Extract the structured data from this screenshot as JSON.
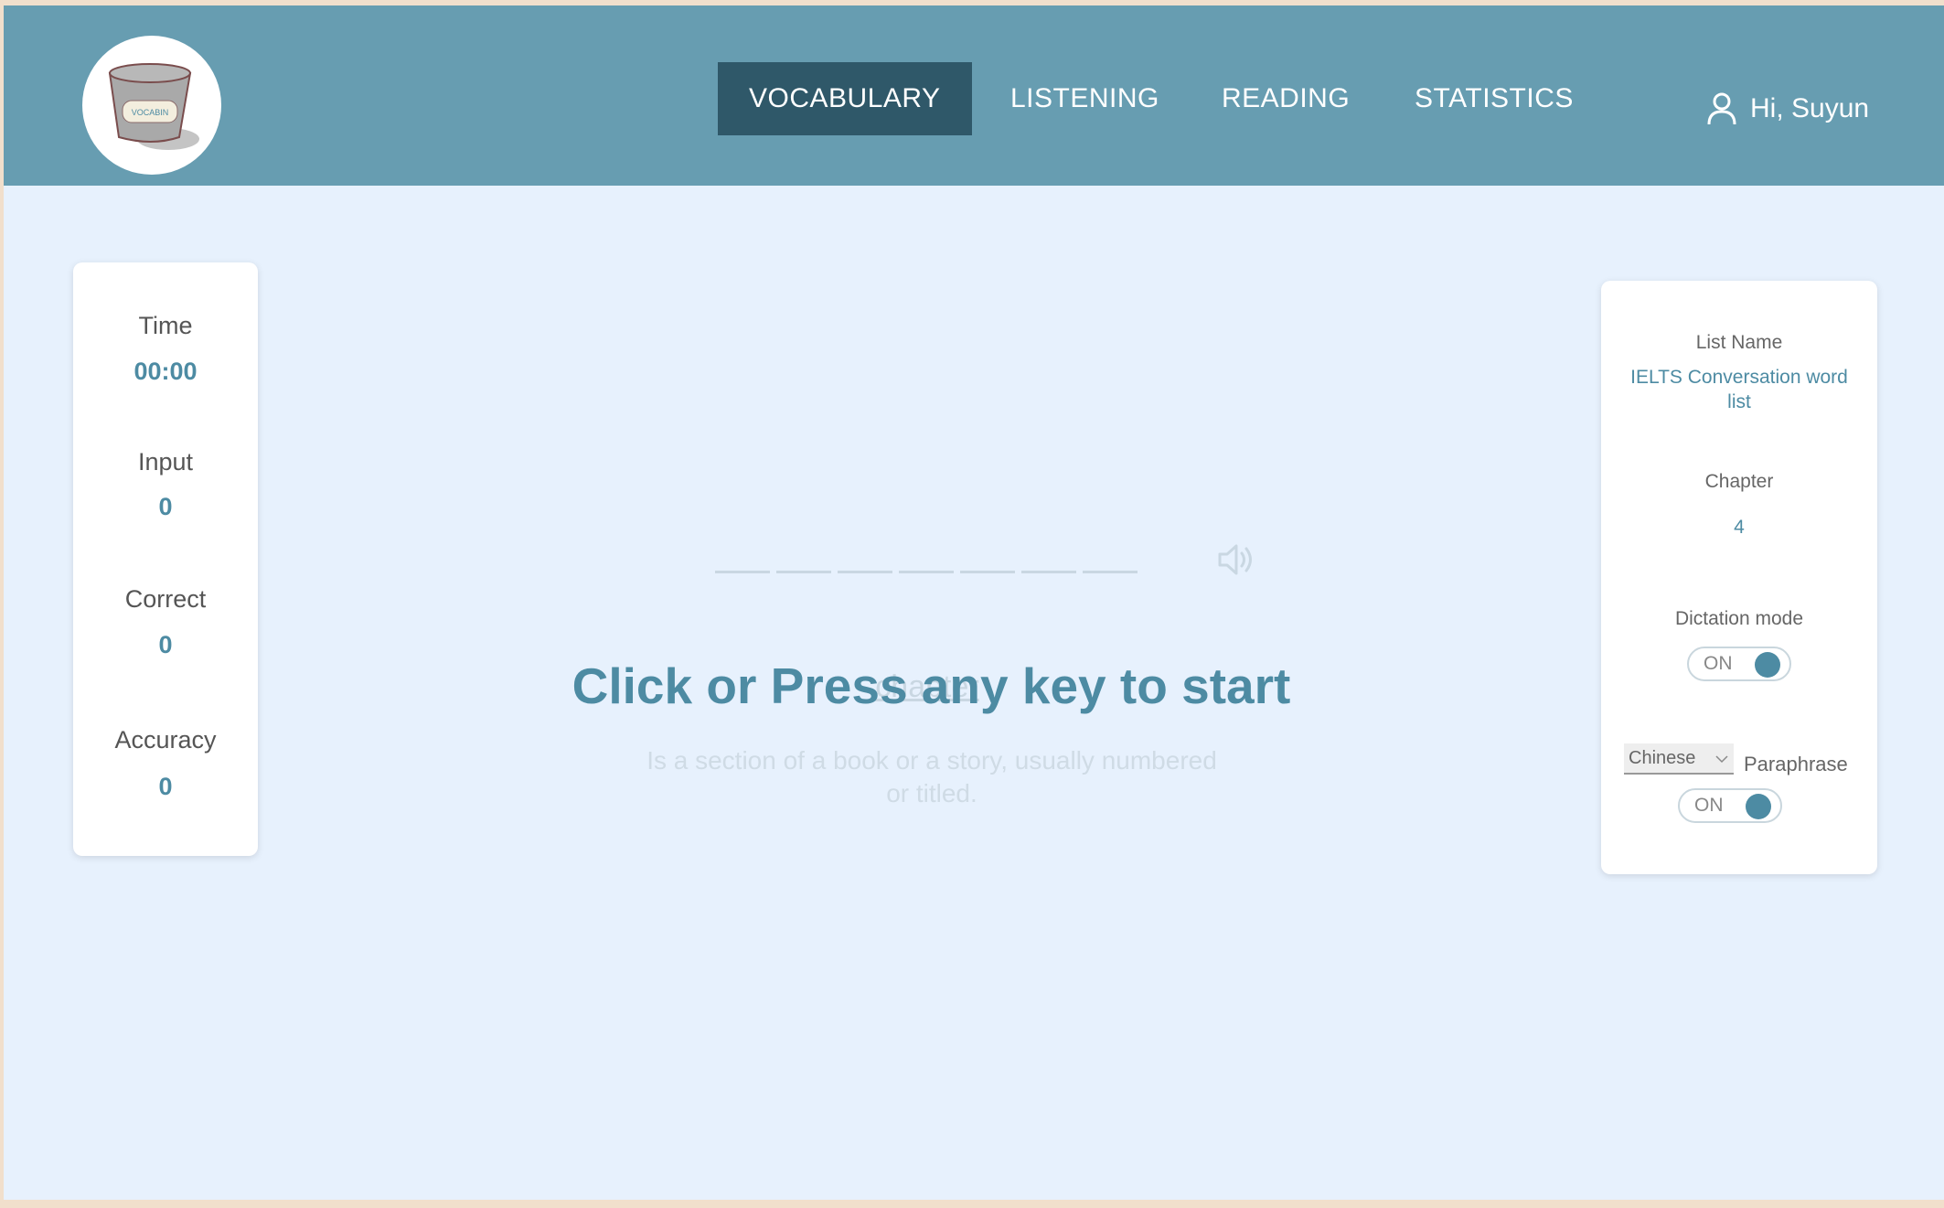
{
  "app": {
    "logo_text": "VOCABIN",
    "brand_color": "#679db1",
    "accent_color": "#4d8ba3"
  },
  "nav": {
    "items": [
      {
        "label": "VOCABULARY",
        "active": true
      },
      {
        "label": "LISTENING",
        "active": false
      },
      {
        "label": "READING",
        "active": false
      },
      {
        "label": "STATISTICS",
        "active": false
      }
    ]
  },
  "user": {
    "greeting": "Hi, Suyun",
    "icon": "user-icon"
  },
  "stats": {
    "time_label": "Time",
    "time_value": "00:00",
    "input_label": "Input",
    "input_value": "0",
    "correct_label": "Correct",
    "correct_value": "0",
    "accuracy_label": "Accuracy",
    "accuracy_value": "0"
  },
  "practice": {
    "start_prompt": "Click or Press any key to start",
    "hint_word": "chapter",
    "definition": "Is a section of a book or a story, usually numbered or titled.",
    "speaker_icon": "speaker-icon"
  },
  "settings": {
    "list_name_label": "List Name",
    "list_name_value": "IELTS Conversation word list",
    "chapter_label": "Chapter",
    "chapter_value": "4",
    "dictation_label": "Dictation mode",
    "dictation_state": "ON",
    "language_selected": "Chinese",
    "paraphrase_label": "Paraphrase",
    "paraphrase_state": "ON"
  }
}
